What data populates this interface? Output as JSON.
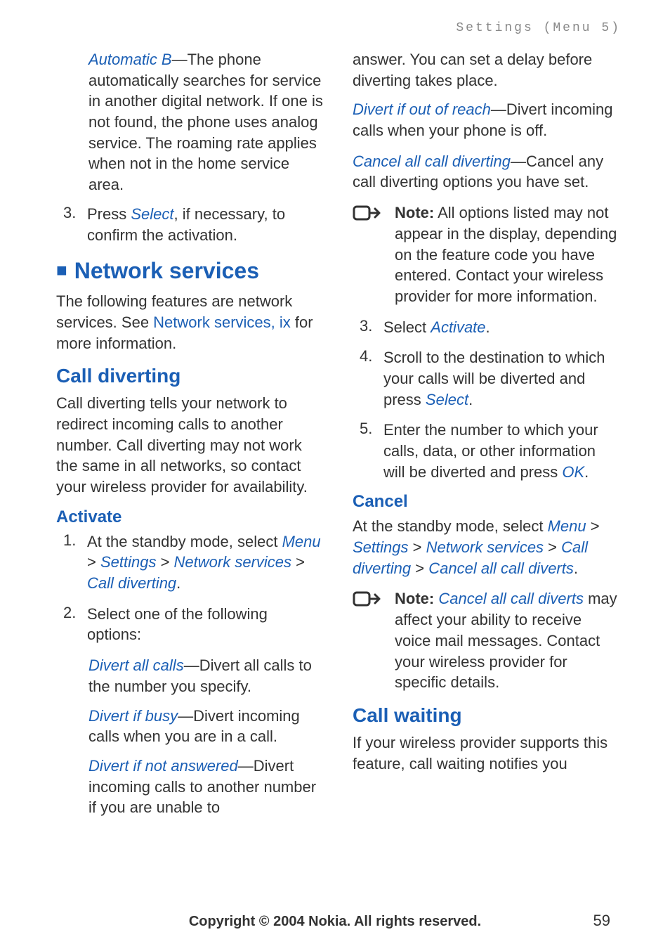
{
  "header": {
    "section_label": "Settings (Menu 5)"
  },
  "left": {
    "auto_b": {
      "term": "Automatic B",
      "desc": "—The phone automatically searches for service in another digital network. If one is not found, the phone uses analog service. The roaming rate applies when not in the home service area."
    },
    "step3": {
      "num": "3.",
      "pre": "Press ",
      "select": "Select",
      "post": ", if necessary, to confirm the activation."
    },
    "h2_network": "Network services",
    "network_intro_pre": "The following features are network services. See ",
    "network_intro_link": "Network services, ix",
    "network_intro_post": " for more information.",
    "h3_call_div": "Call diverting",
    "call_div_desc": "Call diverting tells your network to redirect incoming calls to another number. Call diverting may not work the same in all networks, so contact your wireless provider for availability.",
    "h4_activate": "Activate",
    "act_step1": {
      "num": "1.",
      "pre": "At the standby mode, select ",
      "menu": "Menu",
      "gt1": " > ",
      "settings": "Settings",
      "gt2": " > ",
      "netserv": "Network services",
      "gt3": " > ",
      "calldiv": "Call diverting",
      "period": "."
    },
    "act_step2": {
      "num": "2.",
      "text": "Select one of the following options:"
    },
    "div_all": {
      "term": "Divert all calls",
      "desc": "—Divert all calls to the number you specify."
    },
    "div_busy": {
      "term": "Divert if busy",
      "desc": "—Divert incoming calls when you are in a call."
    },
    "div_na": {
      "term": "Divert if not answered",
      "desc": "—Divert incoming calls to another number if you are unable to"
    }
  },
  "right": {
    "cont": "answer. You can set a delay before diverting takes place.",
    "div_oor": {
      "term": "Divert if out of reach",
      "desc": "—Divert incoming calls when your phone is off."
    },
    "cancel_all": {
      "term": "Cancel all call diverting",
      "desc": "—Cancel any call diverting options you have set."
    },
    "note1": {
      "label": "Note:",
      "body": " All options listed may not appear in the display, depending on the feature code you have entered. Contact your wireless provider for more information."
    },
    "step3": {
      "num": "3.",
      "pre": "Select ",
      "activate": "Activate",
      "period": "."
    },
    "step4": {
      "num": "4.",
      "pre": "Scroll to the destination to which your calls will be diverted and press ",
      "select": "Select",
      "period": "."
    },
    "step5": {
      "num": "5.",
      "pre": "Enter the number to which your calls, data, or other information will be diverted and press ",
      "ok": "OK",
      "period": "."
    },
    "h4_cancel": "Cancel",
    "cancel_path": {
      "pre": "At the standby mode, select ",
      "menu": "Menu",
      "gt1": " > ",
      "settings": "Settings",
      "gt2": " > ",
      "netserv": "Network services",
      "gt3": " > ",
      "calldiv": "Call diverting",
      "gt4": " > ",
      "cancel": "Cancel all call diverts",
      "period": "."
    },
    "note2": {
      "label": "Note:",
      "term": " Cancel all call diverts",
      "body": " may affect your ability to receive voice mail messages. Contact your wireless provider for specific details."
    },
    "h3_call_wait": "Call waiting",
    "call_wait_desc": "If your wireless provider supports this feature, call waiting notifies you"
  },
  "footer": {
    "copyright": "Copyright © 2004 Nokia. All rights reserved.",
    "page": "59"
  }
}
